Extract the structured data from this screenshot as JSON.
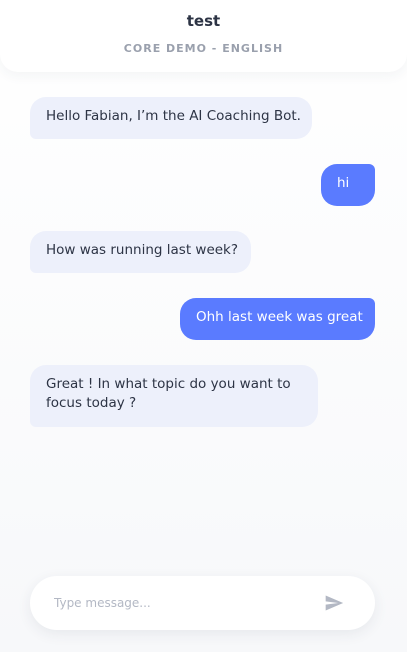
{
  "header": {
    "title": "test",
    "subtitle": "CORE DEMO - ENGLISH"
  },
  "messages": [
    {
      "sender": "bot",
      "text": "Hello Fabian, I’m the AI Coaching Bot."
    },
    {
      "sender": "user",
      "text": "hi"
    },
    {
      "sender": "bot",
      "text": "How was running last week?"
    },
    {
      "sender": "user",
      "text": "Ohh last week was great"
    },
    {
      "sender": "bot",
      "text": "Great ! In what topic do you want to focus today ?"
    }
  ],
  "composer": {
    "placeholder": "Type message...",
    "value": "",
    "send_icon": "send-icon"
  },
  "colors": {
    "user_bubble": "#5a7bff",
    "bot_bubble": "#edf0fb",
    "text": "#2d3445",
    "muted": "#9aa0ad"
  }
}
